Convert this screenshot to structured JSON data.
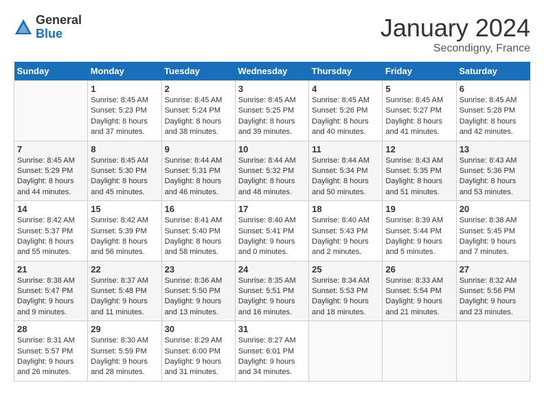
{
  "header": {
    "logo_general": "General",
    "logo_blue": "Blue",
    "month_title": "January 2024",
    "subtitle": "Secondigny, France"
  },
  "days_of_week": [
    "Sunday",
    "Monday",
    "Tuesday",
    "Wednesday",
    "Thursday",
    "Friday",
    "Saturday"
  ],
  "weeks": [
    [
      {
        "day": "",
        "sunrise": "",
        "sunset": "",
        "daylight": ""
      },
      {
        "day": "1",
        "sunrise": "Sunrise: 8:45 AM",
        "sunset": "Sunset: 5:23 PM",
        "daylight": "Daylight: 8 hours and 37 minutes."
      },
      {
        "day": "2",
        "sunrise": "Sunrise: 8:45 AM",
        "sunset": "Sunset: 5:24 PM",
        "daylight": "Daylight: 8 hours and 38 minutes."
      },
      {
        "day": "3",
        "sunrise": "Sunrise: 8:45 AM",
        "sunset": "Sunset: 5:25 PM",
        "daylight": "Daylight: 8 hours and 39 minutes."
      },
      {
        "day": "4",
        "sunrise": "Sunrise: 8:45 AM",
        "sunset": "Sunset: 5:26 PM",
        "daylight": "Daylight: 8 hours and 40 minutes."
      },
      {
        "day": "5",
        "sunrise": "Sunrise: 8:45 AM",
        "sunset": "Sunset: 5:27 PM",
        "daylight": "Daylight: 8 hours and 41 minutes."
      },
      {
        "day": "6",
        "sunrise": "Sunrise: 8:45 AM",
        "sunset": "Sunset: 5:28 PM",
        "daylight": "Daylight: 8 hours and 42 minutes."
      }
    ],
    [
      {
        "day": "7",
        "sunrise": "Sunrise: 8:45 AM",
        "sunset": "Sunset: 5:29 PM",
        "daylight": "Daylight: 8 hours and 44 minutes."
      },
      {
        "day": "8",
        "sunrise": "Sunrise: 8:45 AM",
        "sunset": "Sunset: 5:30 PM",
        "daylight": "Daylight: 8 hours and 45 minutes."
      },
      {
        "day": "9",
        "sunrise": "Sunrise: 8:44 AM",
        "sunset": "Sunset: 5:31 PM",
        "daylight": "Daylight: 8 hours and 46 minutes."
      },
      {
        "day": "10",
        "sunrise": "Sunrise: 8:44 AM",
        "sunset": "Sunset: 5:32 PM",
        "daylight": "Daylight: 8 hours and 48 minutes."
      },
      {
        "day": "11",
        "sunrise": "Sunrise: 8:44 AM",
        "sunset": "Sunset: 5:34 PM",
        "daylight": "Daylight: 8 hours and 50 minutes."
      },
      {
        "day": "12",
        "sunrise": "Sunrise: 8:43 AM",
        "sunset": "Sunset: 5:35 PM",
        "daylight": "Daylight: 8 hours and 51 minutes."
      },
      {
        "day": "13",
        "sunrise": "Sunrise: 8:43 AM",
        "sunset": "Sunset: 5:36 PM",
        "daylight": "Daylight: 8 hours and 53 minutes."
      }
    ],
    [
      {
        "day": "14",
        "sunrise": "Sunrise: 8:42 AM",
        "sunset": "Sunset: 5:37 PM",
        "daylight": "Daylight: 8 hours and 55 minutes."
      },
      {
        "day": "15",
        "sunrise": "Sunrise: 8:42 AM",
        "sunset": "Sunset: 5:39 PM",
        "daylight": "Daylight: 8 hours and 56 minutes."
      },
      {
        "day": "16",
        "sunrise": "Sunrise: 8:41 AM",
        "sunset": "Sunset: 5:40 PM",
        "daylight": "Daylight: 8 hours and 58 minutes."
      },
      {
        "day": "17",
        "sunrise": "Sunrise: 8:40 AM",
        "sunset": "Sunset: 5:41 PM",
        "daylight": "Daylight: 9 hours and 0 minutes."
      },
      {
        "day": "18",
        "sunrise": "Sunrise: 8:40 AM",
        "sunset": "Sunset: 5:43 PM",
        "daylight": "Daylight: 9 hours and 2 minutes."
      },
      {
        "day": "19",
        "sunrise": "Sunrise: 8:39 AM",
        "sunset": "Sunset: 5:44 PM",
        "daylight": "Daylight: 9 hours and 5 minutes."
      },
      {
        "day": "20",
        "sunrise": "Sunrise: 8:38 AM",
        "sunset": "Sunset: 5:45 PM",
        "daylight": "Daylight: 9 hours and 7 minutes."
      }
    ],
    [
      {
        "day": "21",
        "sunrise": "Sunrise: 8:38 AM",
        "sunset": "Sunset: 5:47 PM",
        "daylight": "Daylight: 9 hours and 9 minutes."
      },
      {
        "day": "22",
        "sunrise": "Sunrise: 8:37 AM",
        "sunset": "Sunset: 5:48 PM",
        "daylight": "Daylight: 9 hours and 11 minutes."
      },
      {
        "day": "23",
        "sunrise": "Sunrise: 8:36 AM",
        "sunset": "Sunset: 5:50 PM",
        "daylight": "Daylight: 9 hours and 13 minutes."
      },
      {
        "day": "24",
        "sunrise": "Sunrise: 8:35 AM",
        "sunset": "Sunset: 5:51 PM",
        "daylight": "Daylight: 9 hours and 16 minutes."
      },
      {
        "day": "25",
        "sunrise": "Sunrise: 8:34 AM",
        "sunset": "Sunset: 5:53 PM",
        "daylight": "Daylight: 9 hours and 18 minutes."
      },
      {
        "day": "26",
        "sunrise": "Sunrise: 8:33 AM",
        "sunset": "Sunset: 5:54 PM",
        "daylight": "Daylight: 9 hours and 21 minutes."
      },
      {
        "day": "27",
        "sunrise": "Sunrise: 8:32 AM",
        "sunset": "Sunset: 5:56 PM",
        "daylight": "Daylight: 9 hours and 23 minutes."
      }
    ],
    [
      {
        "day": "28",
        "sunrise": "Sunrise: 8:31 AM",
        "sunset": "Sunset: 5:57 PM",
        "daylight": "Daylight: 9 hours and 26 minutes."
      },
      {
        "day": "29",
        "sunrise": "Sunrise: 8:30 AM",
        "sunset": "Sunset: 5:59 PM",
        "daylight": "Daylight: 9 hours and 28 minutes."
      },
      {
        "day": "30",
        "sunrise": "Sunrise: 8:29 AM",
        "sunset": "Sunset: 6:00 PM",
        "daylight": "Daylight: 9 hours and 31 minutes."
      },
      {
        "day": "31",
        "sunrise": "Sunrise: 8:27 AM",
        "sunset": "Sunset: 6:01 PM",
        "daylight": "Daylight: 9 hours and 34 minutes."
      },
      {
        "day": "",
        "sunrise": "",
        "sunset": "",
        "daylight": ""
      },
      {
        "day": "",
        "sunrise": "",
        "sunset": "",
        "daylight": ""
      },
      {
        "day": "",
        "sunrise": "",
        "sunset": "",
        "daylight": ""
      }
    ]
  ]
}
